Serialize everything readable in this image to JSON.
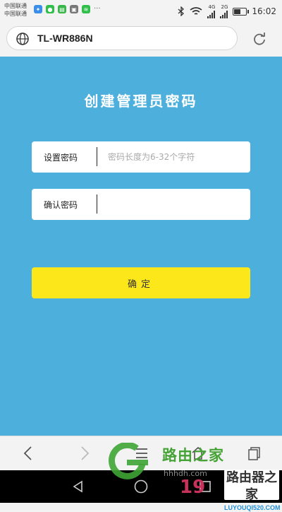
{
  "status_bar": {
    "carrier1": "中国联通",
    "carrier2": "中国联通",
    "net1": "4G",
    "net2": "2G",
    "time": "16:02",
    "battery_level": 0.5
  },
  "browser": {
    "url": "TL-WR886N"
  },
  "page": {
    "title": "创建管理员密码",
    "set_password": {
      "label": "设置密码",
      "placeholder": "密码长度为6-32个字符",
      "value": ""
    },
    "confirm_password": {
      "label": "确认密码",
      "placeholder": "",
      "value": ""
    },
    "confirm_button": "确定"
  },
  "colors": {
    "background": "#4db0dc",
    "button": "#fce71b",
    "field": "#ffffff"
  },
  "icons": [
    "globe-icon",
    "reload-icon",
    "back-icon",
    "forward-icon",
    "menu-icon",
    "home-icon",
    "tabs-icon",
    "nav-back-icon",
    "nav-home-icon",
    "nav-recents-icon"
  ],
  "watermark": {
    "brand": "路由之家",
    "url": "hhhdh.com",
    "number": "19",
    "stamp_text": "路由器之家",
    "stamp_sub": "LUYOUQI520.COM"
  }
}
